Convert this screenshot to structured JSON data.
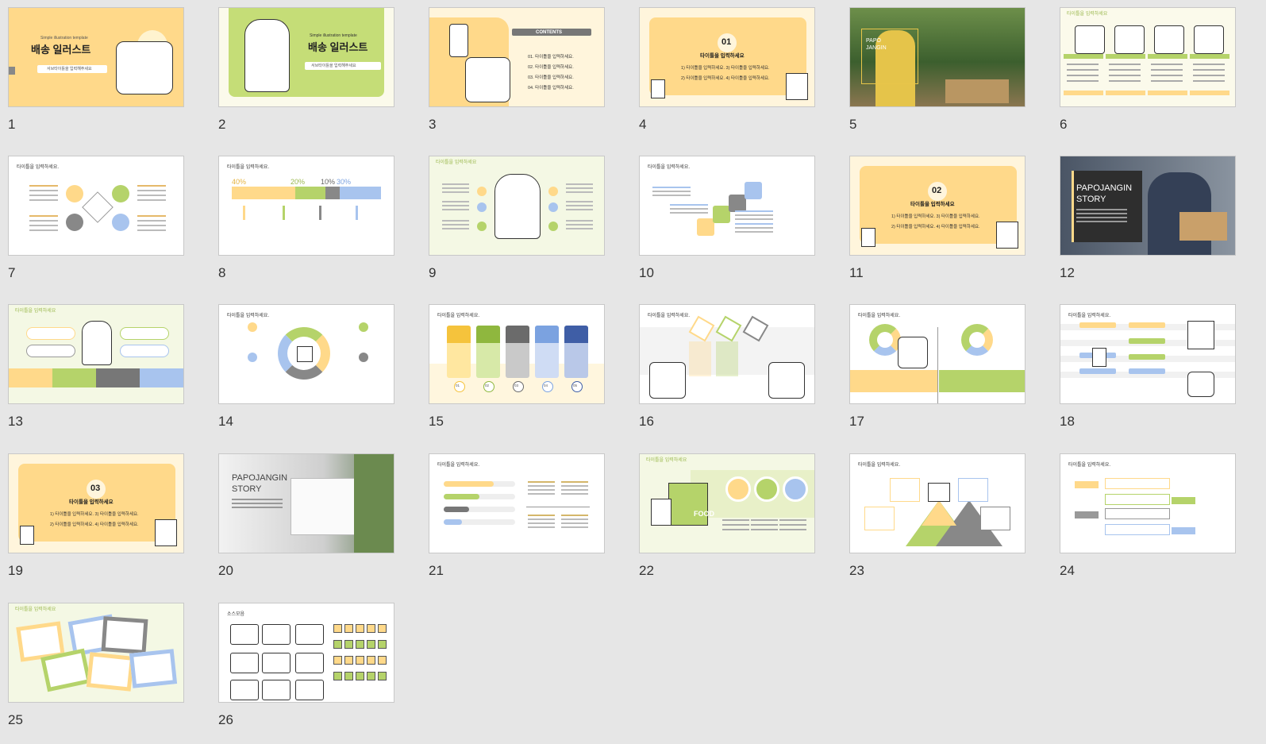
{
  "slides": [
    {
      "num": "1",
      "bg": "#ffd98a",
      "kind": "title",
      "lines": [
        "Simple illustration template",
        "배송 일러스트",
        "서브타이틀을 입력해주세요"
      ]
    },
    {
      "num": "2",
      "bg": "#c5dd77",
      "kind": "title2",
      "lines": [
        "Simple illustration template",
        "배송 일러스트",
        "서브타이틀을 입력해주세요"
      ]
    },
    {
      "num": "3",
      "bg": "#fff5dc",
      "kind": "contents",
      "lines": [
        "CONTENTS",
        "01. 타이틀을 입력하세요.",
        "02. 타이틀을 입력하세요.",
        "03. 타이틀을 입력하세요.",
        "04. 타이틀을 입력하세요."
      ]
    },
    {
      "num": "4",
      "bg": "#fff5dc",
      "kind": "section",
      "lines": [
        "01",
        "타이틀을 입력하세요",
        "1) 타이틀을 입력하세요.  3) 타이틀을 입력하세요.",
        "2) 타이틀을 입력하세요.  4) 타이틀을 입력하세요."
      ]
    },
    {
      "num": "5",
      "bg": "#4e7a3a",
      "kind": "photo",
      "lines": [
        "PAPO",
        "JANGIN"
      ]
    },
    {
      "num": "6",
      "bg": "#fbfaeb",
      "kind": "icons4",
      "lines": [
        "타이틀을 입력하세요"
      ]
    },
    {
      "num": "7",
      "bg": "#ffffff",
      "kind": "cross",
      "lines": [
        "타이틀을 입력하세요."
      ]
    },
    {
      "num": "8",
      "bg": "#ffffff",
      "kind": "percent",
      "lines": [
        "타이틀을 입력하세요.",
        "40%",
        "20%",
        "10%",
        "30%"
      ]
    },
    {
      "num": "9",
      "bg": "#f4f8e4",
      "kind": "center",
      "lines": [
        "타이틀을 입력하세요"
      ]
    },
    {
      "num": "10",
      "bg": "#ffffff",
      "kind": "steps",
      "lines": [
        "타이틀을 입력하세요."
      ]
    },
    {
      "num": "11",
      "bg": "#fff5dc",
      "kind": "section",
      "lines": [
        "02",
        "타이틀을 입력하세요",
        "1) 타이틀을 입력하세요.  3) 타이틀을 입력하세요.",
        "2) 타이틀을 입력하세요.  4) 타이틀을 입력하세요."
      ]
    },
    {
      "num": "12",
      "bg": "#5f6a78",
      "kind": "story",
      "lines": [
        "PAPOJANGIN",
        "STORY"
      ]
    },
    {
      "num": "13",
      "bg": "#f4f8e4",
      "kind": "bubbles",
      "lines": [
        "타이틀을 입력하세요"
      ]
    },
    {
      "num": "14",
      "bg": "#ffffff",
      "kind": "cycle",
      "lines": [
        "타이틀을 입력하세요."
      ]
    },
    {
      "num": "15",
      "bg": "#ffffff",
      "kind": "cards",
      "lines": [
        "타이틀을 입력하세요.",
        "01",
        "02",
        "03",
        "04",
        "05"
      ]
    },
    {
      "num": "16",
      "bg": "#ffffff",
      "kind": "hex",
      "lines": [
        "타이틀을 입력하세요."
      ]
    },
    {
      "num": "17",
      "bg": "#ffffff",
      "kind": "donuts",
      "lines": [
        "타이틀을 입력하세요."
      ]
    },
    {
      "num": "18",
      "bg": "#ffffff",
      "kind": "flow",
      "lines": [
        "타이틀을 입력하세요."
      ]
    },
    {
      "num": "19",
      "bg": "#fff5dc",
      "kind": "section",
      "lines": [
        "03",
        "타이틀을 입력하세요",
        "1) 타이틀을 입력하세요.  3) 타이틀을 입력하세요.",
        "2) 타이틀을 입력하세요.  4) 타이틀을 입력하세요."
      ]
    },
    {
      "num": "20",
      "bg": "#e8e8e8",
      "kind": "story2",
      "lines": [
        "PAPOJANGIN",
        "STORY"
      ]
    },
    {
      "num": "21",
      "bg": "#ffffff",
      "kind": "bars",
      "lines": [
        "타이틀을 입력하세요."
      ]
    },
    {
      "num": "22",
      "bg": "#f4f8e4",
      "kind": "truck",
      "lines": [
        "타이틀을 입력하세요",
        "FOOD"
      ]
    },
    {
      "num": "23",
      "bg": "#ffffff",
      "kind": "pyramid",
      "lines": [
        "타이틀을 입력하세요."
      ]
    },
    {
      "num": "24",
      "bg": "#ffffff",
      "kind": "ladder",
      "lines": [
        "타이틀을 입력하세요."
      ]
    },
    {
      "num": "25",
      "bg": "#f4f8e4",
      "kind": "notes",
      "lines": [
        "타이틀을 입력하세요"
      ]
    },
    {
      "num": "26",
      "bg": "#ffffff",
      "kind": "sources",
      "lines": [
        "소스모음"
      ]
    }
  ],
  "colors": {
    "yellow": "#ffd98a",
    "green": "#b5d36a",
    "gray": "#888888",
    "blue": "#a8c4ee",
    "cream": "#fff5dc"
  }
}
